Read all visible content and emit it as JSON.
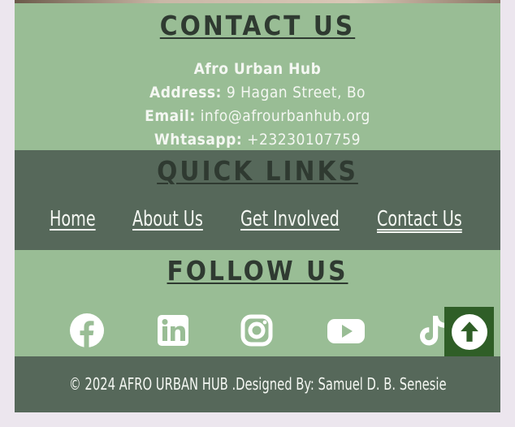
{
  "contact": {
    "heading": "CONTACT US",
    "org_name": "Afro Urban Hub",
    "address_label": "Address:",
    "address_value": "9 Hagan Street, Bo",
    "email_label": "Email:",
    "email_value": "info@afrourbanhub.org",
    "whatsapp_label": "Whtasapp:",
    "whatsapp_value": "+23230107759"
  },
  "quick_links": {
    "heading": "QUICK LINKS",
    "items": [
      {
        "label": "Home"
      },
      {
        "label": "About Us"
      },
      {
        "label": "Get Involved"
      },
      {
        "label": "Contact Us"
      }
    ]
  },
  "follow": {
    "heading": "FOLLOW US",
    "icons": [
      "facebook-icon",
      "linkedin-icon",
      "instagram-icon",
      "youtube-icon",
      "tiktok-icon"
    ]
  },
  "footer": {
    "copyright": "© 2024 AFRO URBAN HUB .Designed By: Samuel D. B. Senesie"
  },
  "colors": {
    "light_green": "#99bd95",
    "dark_green": "#56685a",
    "heading_text": "#2f3a31",
    "back_to_top": "#2f5e27"
  }
}
